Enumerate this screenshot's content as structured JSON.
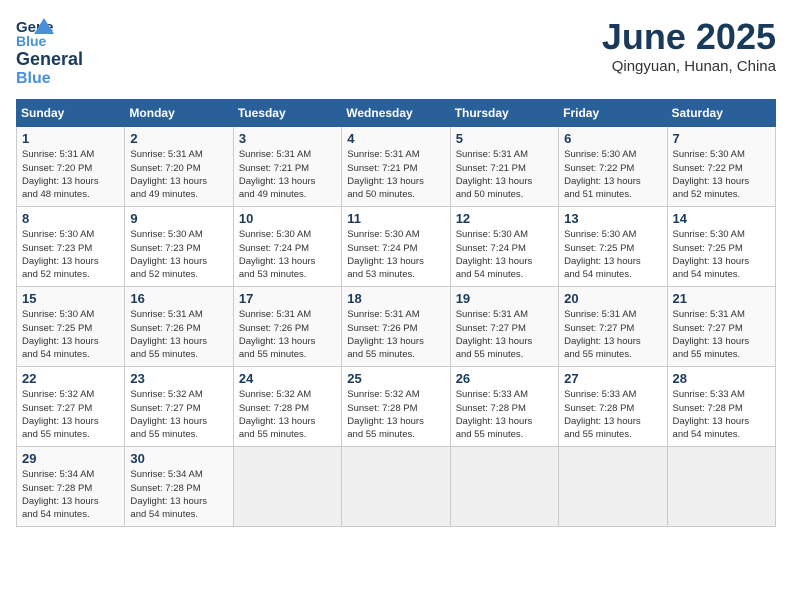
{
  "header": {
    "logo_line1": "General",
    "logo_line2": "Blue",
    "month": "June 2025",
    "location": "Qingyuan, Hunan, China"
  },
  "days_of_week": [
    "Sunday",
    "Monday",
    "Tuesday",
    "Wednesday",
    "Thursday",
    "Friday",
    "Saturday"
  ],
  "weeks": [
    [
      {
        "day": "1",
        "info": "Sunrise: 5:31 AM\nSunset: 7:20 PM\nDaylight: 13 hours\nand 48 minutes."
      },
      {
        "day": "2",
        "info": "Sunrise: 5:31 AM\nSunset: 7:20 PM\nDaylight: 13 hours\nand 49 minutes."
      },
      {
        "day": "3",
        "info": "Sunrise: 5:31 AM\nSunset: 7:21 PM\nDaylight: 13 hours\nand 49 minutes."
      },
      {
        "day": "4",
        "info": "Sunrise: 5:31 AM\nSunset: 7:21 PM\nDaylight: 13 hours\nand 50 minutes."
      },
      {
        "day": "5",
        "info": "Sunrise: 5:31 AM\nSunset: 7:21 PM\nDaylight: 13 hours\nand 50 minutes."
      },
      {
        "day": "6",
        "info": "Sunrise: 5:30 AM\nSunset: 7:22 PM\nDaylight: 13 hours\nand 51 minutes."
      },
      {
        "day": "7",
        "info": "Sunrise: 5:30 AM\nSunset: 7:22 PM\nDaylight: 13 hours\nand 52 minutes."
      }
    ],
    [
      {
        "day": "8",
        "info": "Sunrise: 5:30 AM\nSunset: 7:23 PM\nDaylight: 13 hours\nand 52 minutes."
      },
      {
        "day": "9",
        "info": "Sunrise: 5:30 AM\nSunset: 7:23 PM\nDaylight: 13 hours\nand 52 minutes."
      },
      {
        "day": "10",
        "info": "Sunrise: 5:30 AM\nSunset: 7:24 PM\nDaylight: 13 hours\nand 53 minutes."
      },
      {
        "day": "11",
        "info": "Sunrise: 5:30 AM\nSunset: 7:24 PM\nDaylight: 13 hours\nand 53 minutes."
      },
      {
        "day": "12",
        "info": "Sunrise: 5:30 AM\nSunset: 7:24 PM\nDaylight: 13 hours\nand 54 minutes."
      },
      {
        "day": "13",
        "info": "Sunrise: 5:30 AM\nSunset: 7:25 PM\nDaylight: 13 hours\nand 54 minutes."
      },
      {
        "day": "14",
        "info": "Sunrise: 5:30 AM\nSunset: 7:25 PM\nDaylight: 13 hours\nand 54 minutes."
      }
    ],
    [
      {
        "day": "15",
        "info": "Sunrise: 5:30 AM\nSunset: 7:25 PM\nDaylight: 13 hours\nand 54 minutes."
      },
      {
        "day": "16",
        "info": "Sunrise: 5:31 AM\nSunset: 7:26 PM\nDaylight: 13 hours\nand 55 minutes."
      },
      {
        "day": "17",
        "info": "Sunrise: 5:31 AM\nSunset: 7:26 PM\nDaylight: 13 hours\nand 55 minutes."
      },
      {
        "day": "18",
        "info": "Sunrise: 5:31 AM\nSunset: 7:26 PM\nDaylight: 13 hours\nand 55 minutes."
      },
      {
        "day": "19",
        "info": "Sunrise: 5:31 AM\nSunset: 7:27 PM\nDaylight: 13 hours\nand 55 minutes."
      },
      {
        "day": "20",
        "info": "Sunrise: 5:31 AM\nSunset: 7:27 PM\nDaylight: 13 hours\nand 55 minutes."
      },
      {
        "day": "21",
        "info": "Sunrise: 5:31 AM\nSunset: 7:27 PM\nDaylight: 13 hours\nand 55 minutes."
      }
    ],
    [
      {
        "day": "22",
        "info": "Sunrise: 5:32 AM\nSunset: 7:27 PM\nDaylight: 13 hours\nand 55 minutes."
      },
      {
        "day": "23",
        "info": "Sunrise: 5:32 AM\nSunset: 7:27 PM\nDaylight: 13 hours\nand 55 minutes."
      },
      {
        "day": "24",
        "info": "Sunrise: 5:32 AM\nSunset: 7:28 PM\nDaylight: 13 hours\nand 55 minutes."
      },
      {
        "day": "25",
        "info": "Sunrise: 5:32 AM\nSunset: 7:28 PM\nDaylight: 13 hours\nand 55 minutes."
      },
      {
        "day": "26",
        "info": "Sunrise: 5:33 AM\nSunset: 7:28 PM\nDaylight: 13 hours\nand 55 minutes."
      },
      {
        "day": "27",
        "info": "Sunrise: 5:33 AM\nSunset: 7:28 PM\nDaylight: 13 hours\nand 55 minutes."
      },
      {
        "day": "28",
        "info": "Sunrise: 5:33 AM\nSunset: 7:28 PM\nDaylight: 13 hours\nand 54 minutes."
      }
    ],
    [
      {
        "day": "29",
        "info": "Sunrise: 5:34 AM\nSunset: 7:28 PM\nDaylight: 13 hours\nand 54 minutes."
      },
      {
        "day": "30",
        "info": "Sunrise: 5:34 AM\nSunset: 7:28 PM\nDaylight: 13 hours\nand 54 minutes."
      },
      {
        "day": "",
        "info": ""
      },
      {
        "day": "",
        "info": ""
      },
      {
        "day": "",
        "info": ""
      },
      {
        "day": "",
        "info": ""
      },
      {
        "day": "",
        "info": ""
      }
    ]
  ]
}
